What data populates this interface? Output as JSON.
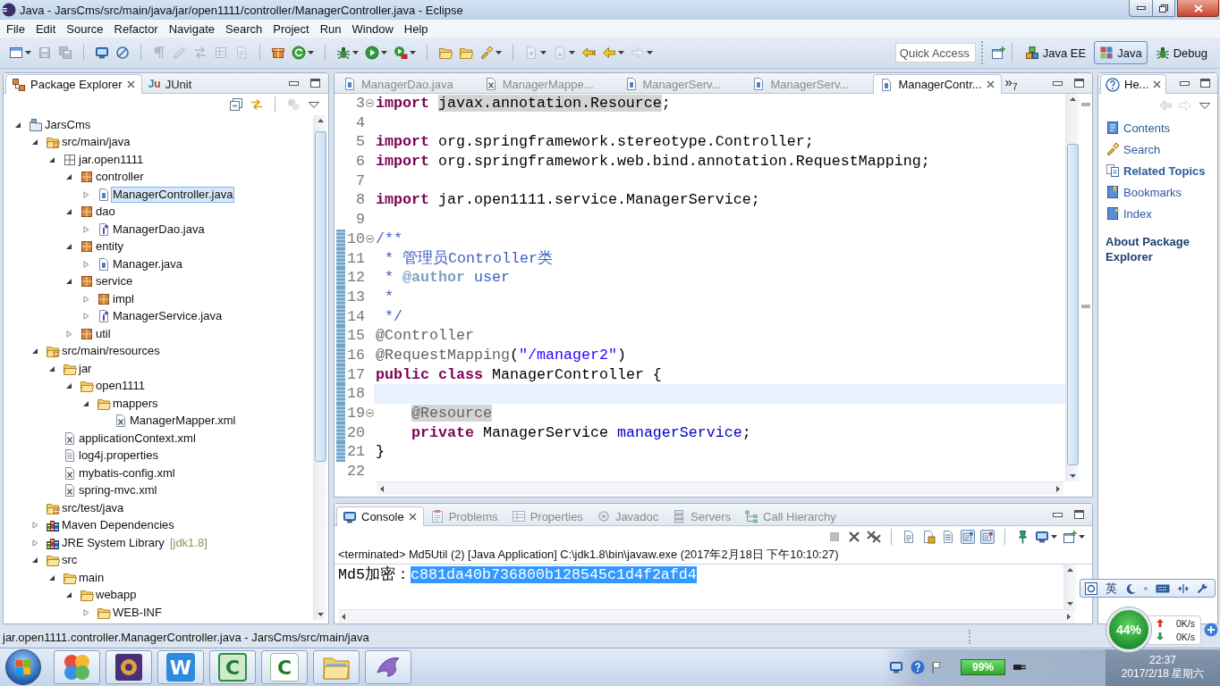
{
  "window": {
    "title": "Java - JarsCms/src/main/java/jar/open1111/controller/ManagerController.java - Eclipse"
  },
  "menu": [
    "File",
    "Edit",
    "Source",
    "Refactor",
    "Navigate",
    "Search",
    "Project",
    "Run",
    "Window",
    "Help"
  ],
  "toolbar": [
    [
      {
        "kind": "new",
        "dropdown": true,
        "disabled": false
      },
      {
        "kind": "save",
        "disabled": true
      },
      {
        "kind": "save-all",
        "disabled": true
      }
    ],
    [
      {
        "kind": "monitor",
        "disabled": false
      },
      {
        "kind": "slash",
        "disabled": false
      }
    ],
    [
      {
        "kind": "pilcrow",
        "disabled": true
      },
      {
        "kind": "pen",
        "disabled": true
      },
      {
        "kind": "arrows",
        "disabled": true
      },
      {
        "kind": "grid",
        "disabled": true
      },
      {
        "kind": "page",
        "disabled": true
      }
    ],
    [
      {
        "kind": "box",
        "disabled": false
      },
      {
        "kind": "refresh",
        "dropdown": true,
        "disabled": false
      }
    ],
    [
      {
        "kind": "bug",
        "dropdown": true,
        "disabled": false
      },
      {
        "kind": "run",
        "dropdown": true,
        "disabled": false
      },
      {
        "kind": "tool",
        "dropdown": true,
        "disabled": false
      }
    ],
    [
      {
        "kind": "folder",
        "disabled": false
      },
      {
        "kind": "folder",
        "disabled": false
      },
      {
        "kind": "flashlight",
        "dropdown": true,
        "disabled": false
      }
    ],
    [
      {
        "kind": "pagedown",
        "dropdown": true,
        "disabled": true
      },
      {
        "kind": "pageup",
        "dropdown": true,
        "disabled": true
      },
      {
        "kind": "lastedit",
        "disabled": false
      },
      {
        "kind": "back",
        "dropdown": true,
        "disabled": false
      },
      {
        "kind": "forward",
        "dropdown": true,
        "disabled": true
      }
    ]
  ],
  "quick_access": {
    "placeholder": "Quick Access"
  },
  "perspectives": [
    {
      "label": "Java EE",
      "kind": "javaee",
      "selected": false
    },
    {
      "label": "Java",
      "kind": "java",
      "selected": true
    },
    {
      "label": "Debug",
      "kind": "debug",
      "selected": false
    }
  ],
  "package_explorer": {
    "tabs": [
      {
        "label": "Package Explorer",
        "kind": "packages",
        "selected": true
      },
      {
        "label": "JUnit",
        "badge": "Ju",
        "selected": false
      }
    ],
    "toolbar": [
      [
        {
          "kind": "collapse",
          "disabled": false
        },
        {
          "kind": "link",
          "disabled": false
        }
      ],
      [
        {
          "kind": "filter",
          "disabled": true
        },
        {
          "kind": "menu",
          "disabled": false
        }
      ]
    ],
    "tree": [
      {
        "label": "JarsCms",
        "kind": "project",
        "expanded": true,
        "selected": false,
        "children": [
          {
            "label": "src/main/java",
            "kind": "source-folder",
            "expanded": true,
            "selected": false,
            "children": [
              {
                "label": "jar.open1111",
                "kind": "empty-package",
                "expanded": true,
                "selected": false,
                "children": [
                  {
                    "label": "controller",
                    "kind": "package",
                    "expanded": true,
                    "selected": false,
                    "children": [
                      {
                        "label": "ManagerController.java",
                        "kind": "java-file",
                        "expanded": false,
                        "selected": true
                      }
                    ]
                  },
                  {
                    "label": "dao",
                    "kind": "package",
                    "expanded": true,
                    "selected": false,
                    "children": [
                      {
                        "label": "ManagerDao.java",
                        "kind": "interface-file",
                        "expanded": false,
                        "selected": false
                      }
                    ]
                  },
                  {
                    "label": "entity",
                    "kind": "package",
                    "expanded": true,
                    "selected": false,
                    "children": [
                      {
                        "label": "Manager.java",
                        "kind": "java-file",
                        "expanded": false,
                        "selected": false
                      }
                    ]
                  },
                  {
                    "label": "service",
                    "kind": "package",
                    "expanded": true,
                    "selected": false,
                    "children": [
                      {
                        "label": "impl",
                        "kind": "package",
                        "expanded": false,
                        "selected": false
                      },
                      {
                        "label": "ManagerService.java",
                        "kind": "interface-file",
                        "expanded": false,
                        "selected": false
                      }
                    ]
                  },
                  {
                    "label": "util",
                    "kind": "package",
                    "expanded": false,
                    "selected": false
                  }
                ]
              }
            ]
          },
          {
            "label": "src/main/resources",
            "kind": "source-folder",
            "expanded": true,
            "selected": false,
            "children": [
              {
                "label": "jar",
                "kind": "folder",
                "expanded": true,
                "selected": false,
                "children": [
                  {
                    "label": "open1111",
                    "kind": "folder",
                    "expanded": true,
                    "selected": false,
                    "children": [
                      {
                        "label": "mappers",
                        "kind": "folder",
                        "expanded": true,
                        "selected": false,
                        "children": [
                          {
                            "label": "ManagerMapper.xml",
                            "kind": "xml-file",
                            "selected": false
                          }
                        ]
                      }
                    ]
                  }
                ]
              },
              {
                "label": "applicationContext.xml",
                "kind": "xml-file",
                "selected": false
              },
              {
                "label": "log4j.properties",
                "kind": "properties-file",
                "selected": false
              },
              {
                "label": "mybatis-config.xml",
                "kind": "xml-file",
                "selected": false
              },
              {
                "label": "spring-mvc.xml",
                "kind": "xml-file",
                "selected": false
              }
            ]
          },
          {
            "label": "src/test/java",
            "kind": "source-folder",
            "selected": false
          },
          {
            "label": "Maven Dependencies",
            "kind": "library",
            "expanded": false,
            "selected": false
          },
          {
            "label": "JRE System Library",
            "decoration": "[jdk1.8]",
            "kind": "library",
            "expanded": false,
            "selected": false
          },
          {
            "label": "src",
            "kind": "folder",
            "expanded": true,
            "selected": false,
            "children": [
              {
                "label": "main",
                "kind": "folder",
                "expanded": true,
                "selected": false,
                "children": [
                  {
                    "label": "webapp",
                    "kind": "folder",
                    "expanded": true,
                    "selected": false,
                    "children": [
                      {
                        "label": "WEB-INF",
                        "kind": "folder",
                        "expanded": false,
                        "selected": false
                      }
                    ]
                  }
                ]
              }
            ]
          }
        ]
      }
    ]
  },
  "editor": {
    "tabs": [
      {
        "label": "ManagerDao.java",
        "kind": "java",
        "selected": false
      },
      {
        "label": "ManagerMappe...",
        "kind": "xml",
        "selected": false
      },
      {
        "label": "ManagerServ...",
        "kind": "java",
        "selected": false
      },
      {
        "label": "ManagerServ...",
        "kind": "java",
        "selected": false
      },
      {
        "label": "ManagerContr...",
        "kind": "java",
        "selected": true
      }
    ],
    "overflow": "»$_{7}$",
    "lines": [
      {
        "number": "3",
        "fold": true,
        "range": false,
        "current": false,
        "tokens": [
          {
            "text": "import ",
            "kind": "keyword",
            "marked": false
          },
          {
            "text": "javax.annotation.Resource",
            "kind": "plain",
            "marked": true
          },
          {
            "text": ";",
            "kind": "plain",
            "marked": false
          }
        ]
      },
      {
        "number": "4",
        "fold": false,
        "range": false,
        "current": false
      },
      {
        "number": "5",
        "fold": false,
        "range": false,
        "current": false,
        "tokens": [
          {
            "text": "import",
            "kind": "keyword",
            "marked": false
          },
          {
            "text": " org.springframework.stereotype.Controller;",
            "kind": "plain",
            "marked": false
          }
        ]
      },
      {
        "number": "6",
        "fold": false,
        "range": false,
        "current": false,
        "tokens": [
          {
            "text": "import",
            "kind": "keyword",
            "marked": false
          },
          {
            "text": " org.springframework.web.bind.annotation.RequestMapping;",
            "kind": "plain",
            "marked": false
          }
        ]
      },
      {
        "number": "7",
        "fold": false,
        "range": false,
        "current": false
      },
      {
        "number": "8",
        "fold": false,
        "range": false,
        "current": false,
        "tokens": [
          {
            "text": "import",
            "kind": "keyword",
            "marked": false
          },
          {
            "text": " jar.open1111.service.ManagerService;",
            "kind": "plain",
            "marked": false
          }
        ]
      },
      {
        "number": "9",
        "fold": false,
        "range": false,
        "current": false
      },
      {
        "number": "10",
        "fold": true,
        "range": true,
        "current": false,
        "tokens": [
          {
            "text": "/**",
            "kind": "doc",
            "marked": false
          }
        ]
      },
      {
        "number": "11",
        "fold": false,
        "range": true,
        "current": false,
        "tokens": [
          {
            "text": " * 管理员Controller类",
            "kind": "doc",
            "marked": false
          }
        ]
      },
      {
        "number": "12",
        "fold": false,
        "range": true,
        "current": false,
        "tokens": [
          {
            "text": " * ",
            "kind": "doc",
            "marked": false
          },
          {
            "text": "@author",
            "kind": "doctag",
            "marked": false
          },
          {
            "text": " user",
            "kind": "doc",
            "marked": false
          }
        ]
      },
      {
        "number": "13",
        "fold": false,
        "range": true,
        "current": false,
        "tokens": [
          {
            "text": " *",
            "kind": "doc",
            "marked": false
          }
        ]
      },
      {
        "number": "14",
        "fold": false,
        "range": true,
        "current": false,
        "tokens": [
          {
            "text": " */",
            "kind": "doc",
            "marked": false
          }
        ]
      },
      {
        "number": "15",
        "fold": false,
        "range": true,
        "current": false,
        "tokens": [
          {
            "text": "@Controller",
            "kind": "annotation",
            "marked": false
          }
        ]
      },
      {
        "number": "16",
        "fold": false,
        "range": true,
        "current": false,
        "tokens": [
          {
            "text": "@RequestMapping",
            "kind": "annotation",
            "marked": false
          },
          {
            "text": "(",
            "kind": "plain",
            "marked": false
          },
          {
            "text": "\"/manager2\"",
            "kind": "string",
            "marked": false
          },
          {
            "text": ")",
            "kind": "plain",
            "marked": false
          }
        ]
      },
      {
        "number": "17",
        "fold": false,
        "range": true,
        "current": false,
        "tokens": [
          {
            "text": "public ",
            "kind": "keyword",
            "marked": false
          },
          {
            "text": "class",
            "kind": "keyword",
            "marked": false
          },
          {
            "text": " ManagerController {",
            "kind": "plain",
            "marked": false
          }
        ]
      },
      {
        "number": "18",
        "fold": false,
        "range": true,
        "current": true
      },
      {
        "number": "19",
        "fold": true,
        "range": true,
        "current": false,
        "tokens": [
          {
            "text": "    @Resource",
            "kind": "annotation",
            "marked": true
          }
        ]
      },
      {
        "number": "20",
        "fold": false,
        "range": true,
        "current": false,
        "tokens": [
          {
            "text": "    private",
            "kind": "keyword",
            "marked": false
          },
          {
            "text": " ManagerService ",
            "kind": "plain",
            "marked": false
          },
          {
            "text": "managerService",
            "kind": "field",
            "marked": false
          },
          {
            "text": ";",
            "kind": "plain",
            "marked": false
          }
        ]
      },
      {
        "number": "21",
        "fold": false,
        "range": true,
        "current": false,
        "tokens": [
          {
            "text": "}",
            "kind": "plain",
            "marked": false
          }
        ]
      },
      {
        "number": "22",
        "fold": false,
        "range": false,
        "current": false
      }
    ]
  },
  "console": {
    "tabs": [
      {
        "label": "Console",
        "kind": "console",
        "selected": true
      },
      {
        "label": "Problems",
        "kind": "problems",
        "selected": false
      },
      {
        "label": "Properties",
        "kind": "properties",
        "selected": false
      },
      {
        "label": "Javadoc",
        "kind": "javadoc",
        "selected": false
      },
      {
        "label": "Servers",
        "kind": "servers",
        "selected": false
      },
      {
        "label": "Call Hierarchy",
        "kind": "hierarchy",
        "selected": false
      }
    ],
    "toolbar": [
      [
        {
          "kind": "stop",
          "disabled": true
        },
        {
          "kind": "remove",
          "disabled": false
        },
        {
          "kind": "removeall",
          "disabled": false
        }
      ],
      [
        {
          "kind": "clear",
          "disabled": false
        },
        {
          "kind": "lock",
          "disabled": false
        },
        {
          "kind": "wrap",
          "disabled": false
        },
        {
          "kind": "out",
          "disabled": false,
          "pressed": true
        },
        {
          "kind": "err",
          "disabled": false,
          "pressed": true
        }
      ],
      [
        {
          "kind": "pin",
          "disabled": false
        },
        {
          "kind": "display",
          "dropdown": true,
          "disabled": false
        },
        {
          "kind": "newconsole",
          "dropdown": true,
          "disabled": false
        }
      ]
    ],
    "process": "<terminated> Md5Util (2) [Java Application] C:\\jdk1.8\\bin\\javaw.exe (2017年2月18日 下午10:10:27)",
    "output": [
      {
        "text": "Md5加密：",
        "selected": false
      },
      {
        "text": "c881da40b736800b128545c1d4f2afd4",
        "selected": true
      }
    ]
  },
  "help": {
    "tab": {
      "label": "He...",
      "selected": true
    },
    "toolbar": [
      [
        {
          "kind": "back",
          "disabled": true
        },
        {
          "kind": "forward",
          "disabled": true
        },
        {
          "kind": "menu",
          "disabled": false
        }
      ]
    ],
    "links": [
      {
        "label": "Contents",
        "kind": "contents",
        "selected": false
      },
      {
        "label": "Search",
        "kind": "search",
        "selected": false
      },
      {
        "label": "Related Topics",
        "kind": "related",
        "selected": true
      },
      {
        "label": "Bookmarks",
        "kind": "bookmarks",
        "selected": false
      },
      {
        "label": "Index",
        "kind": "index",
        "selected": false
      }
    ],
    "heading": "About Package Explorer"
  },
  "status_bar": "jar.open1111.controller.ManagerController.java - JarsCms/src/main/java",
  "taskbar": {
    "apps": [
      {
        "kind": "balls"
      },
      {
        "kind": "ide"
      },
      {
        "kind": "wps",
        "glyph": "W"
      },
      {
        "kind": "recorder",
        "glyph": "C"
      },
      {
        "kind": "editor",
        "glyph": "C"
      },
      {
        "kind": "files"
      },
      {
        "kind": "dolphin"
      }
    ],
    "battery": "99%",
    "time": "22:37",
    "date": "2017/2/18 星期六"
  },
  "ime_bar": {
    "mode": "英"
  },
  "net_monitor": {
    "usage": "44%",
    "upload": "0K/s",
    "download": "0K/s"
  }
}
